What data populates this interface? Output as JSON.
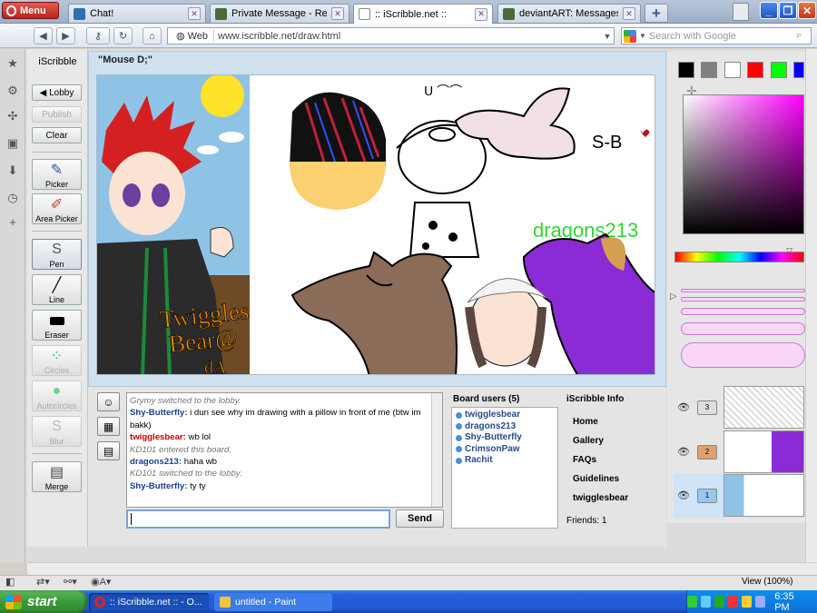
{
  "browser": {
    "menu_label": "Menu",
    "tabs": [
      {
        "label": "Chat!",
        "icon": "chat-icon"
      },
      {
        "label": "Private Message - Re: h...",
        "icon": "deviantart-icon"
      },
      {
        "label": ":: iScribble.net ::",
        "icon": "iscribble-icon"
      },
      {
        "label": "deviantART: Messages",
        "icon": "deviantart-icon"
      }
    ],
    "new_tab_label": "+",
    "address_scope": "Web",
    "url": "www.iscribble.net/draw.html",
    "search_placeholder": "Search with Google"
  },
  "app": {
    "title": "iScribble",
    "buttons": {
      "lobby": "◀ Lobby",
      "publish": "Publish",
      "clear": "Clear"
    },
    "tools": [
      {
        "label": "Picker",
        "icon": "eyedropper-icon"
      },
      {
        "label": "Area Picker",
        "icon": "area-picker-icon"
      },
      {
        "label": "Pen",
        "icon": "pen-icon"
      },
      {
        "label": "Line",
        "icon": "line-icon"
      },
      {
        "label": "Eraser",
        "icon": "eraser-icon"
      },
      {
        "label": "Circles",
        "icon": "circles-icon"
      },
      {
        "label": "Autocircles",
        "icon": "autocircles-icon"
      },
      {
        "label": "Blur",
        "icon": "blur-icon"
      },
      {
        "label": "Merge",
        "icon": "merge-icon"
      }
    ],
    "board_title": "\"Mouse D;\""
  },
  "canvas_texts": {
    "twiggles": "Twiggles",
    "bear": "Bear@",
    "da": "dA",
    "sb": "S-B",
    "dragons": "dragons213"
  },
  "colors": {
    "palette": [
      "#000000",
      "#808080",
      "#ffffff",
      "#ff0000",
      "#00ff00",
      "#0000ff"
    ],
    "accent": "#7ba3d2",
    "username_red": "#cc0000",
    "username_blue": "#1a3c8c"
  },
  "chat": {
    "messages": [
      {
        "type": "system",
        "text": "Grymy switched to the lobby."
      },
      {
        "type": "user",
        "name": "Shy-Butterfly:",
        "color": "#1a3c8c",
        "text": " i dun see why im drawing with a pillow in front of me (btw im bakk)"
      },
      {
        "type": "user",
        "name": "twigglesbear:",
        "color": "#cc0000",
        "text": " wb lol"
      },
      {
        "type": "system",
        "text": "KD101 entered this board."
      },
      {
        "type": "user",
        "name": "dragons213:",
        "color": "#1a3c8c",
        "text": " haha wb"
      },
      {
        "type": "system",
        "text": "KD101 switched to the lobby."
      },
      {
        "type": "user",
        "name": "Shy-Butterfly:",
        "color": "#1a3c8c",
        "text": " ty ty"
      }
    ],
    "input_value": "",
    "send_label": "Send"
  },
  "board_users": {
    "title": "Board users (5)",
    "users": [
      "twigglesbear",
      "dragons213",
      "Shy-Butterfly",
      "CrimsonPaw",
      "Rachit"
    ]
  },
  "info": {
    "title": "iScribble Info",
    "links": [
      "Home",
      "Gallery",
      "FAQs",
      "Guidelines",
      "twigglesbear"
    ],
    "friends": "Friends: 1"
  },
  "layers": [
    {
      "label": "3"
    },
    {
      "label": "2"
    },
    {
      "label": "1"
    }
  ],
  "status": {
    "zoom": "View (100%)"
  },
  "taskbar": {
    "start_label": "start",
    "items": [
      ":: iScribble.net :: - O...",
      "untitled - Paint"
    ],
    "clock": "6:35 PM"
  }
}
